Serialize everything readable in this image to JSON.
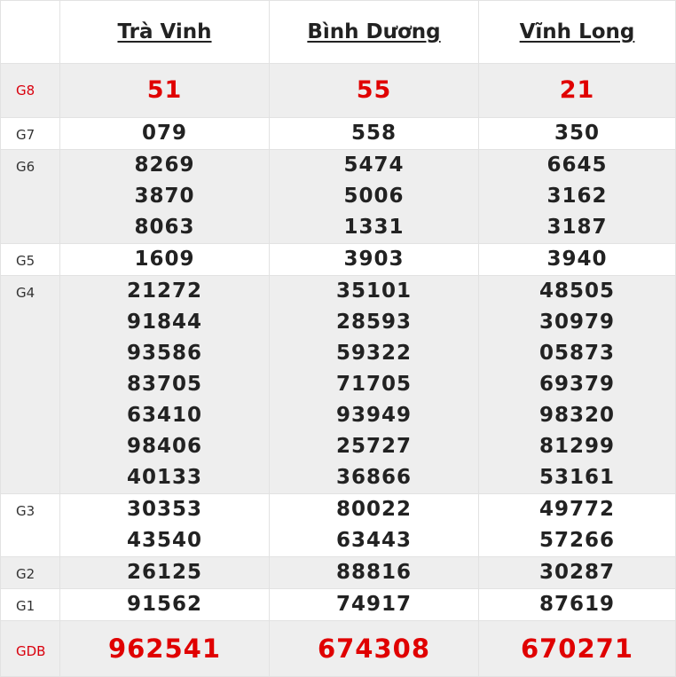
{
  "provinces": [
    "Trà Vinh",
    "Bình Dương",
    "Vĩnh Long"
  ],
  "prizes": [
    {
      "label": "G8",
      "values": [
        [
          "51"
        ],
        [
          "55"
        ],
        [
          "21"
        ]
      ]
    },
    {
      "label": "G7",
      "values": [
        [
          "079"
        ],
        [
          "558"
        ],
        [
          "350"
        ]
      ]
    },
    {
      "label": "G6",
      "values": [
        [
          "8269",
          "3870",
          "8063"
        ],
        [
          "5474",
          "5006",
          "1331"
        ],
        [
          "6645",
          "3162",
          "3187"
        ]
      ]
    },
    {
      "label": "G5",
      "values": [
        [
          "1609"
        ],
        [
          "3903"
        ],
        [
          "3940"
        ]
      ]
    },
    {
      "label": "G4",
      "values": [
        [
          "21272",
          "91844",
          "93586",
          "83705",
          "63410",
          "98406",
          "40133"
        ],
        [
          "35101",
          "28593",
          "59322",
          "71705",
          "93949",
          "25727",
          "36866"
        ],
        [
          "48505",
          "30979",
          "05873",
          "69379",
          "98320",
          "81299",
          "53161"
        ]
      ]
    },
    {
      "label": "G3",
      "values": [
        [
          "30353",
          "43540"
        ],
        [
          "80022",
          "63443"
        ],
        [
          "49772",
          "57266"
        ]
      ]
    },
    {
      "label": "G2",
      "values": [
        [
          "26125"
        ],
        [
          "88816"
        ],
        [
          "30287"
        ]
      ]
    },
    {
      "label": "G1",
      "values": [
        [
          "91562"
        ],
        [
          "74917"
        ],
        [
          "87619"
        ]
      ]
    },
    {
      "label": "GDB",
      "values": [
        [
          "962541"
        ],
        [
          "674308"
        ],
        [
          "670271"
        ]
      ]
    }
  ],
  "colors": {
    "highlight_red": "#e00000",
    "label_red": "#d9000d",
    "text": "#222222",
    "shade": "#eeeeee",
    "border": "#e2e2e2"
  }
}
